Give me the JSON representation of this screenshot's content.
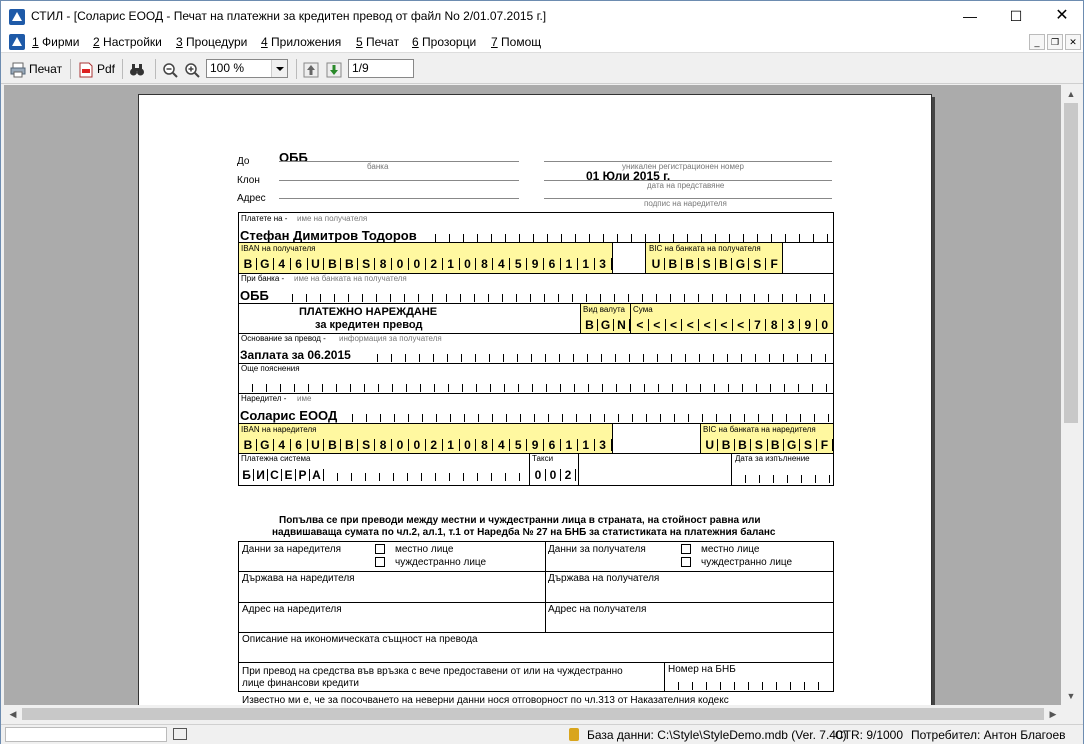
{
  "window": {
    "title": "СТИЛ - [Соларис ЕООД - Печат на платежни за кредитен превод от файл No 2/01.07.2015 г.]"
  },
  "menu": [
    {
      "num": "1",
      "label": " Фирми"
    },
    {
      "num": "2",
      "label": " Настройки"
    },
    {
      "num": "3",
      "label": " Процедури"
    },
    {
      "num": "4",
      "label": " Приложения"
    },
    {
      "num": "5",
      "label": " Печат"
    },
    {
      "num": "6",
      "label": " Прозорци"
    },
    {
      "num": "7",
      "label": " Помощ"
    }
  ],
  "toolbar": {
    "print_label": "Печат",
    "pdf_label": "Pdf",
    "zoom": "100 %",
    "page": "1/9"
  },
  "form": {
    "do_label": "До",
    "bank_value": "ОББ",
    "bank_hint": "банка",
    "klon_label": "Клон",
    "adres_label": "Адрес",
    "reg_hint": "уникален регистрационен номер",
    "date_value": "01 Юли 2015 г.",
    "date_hint": "дата на представяне",
    "sign_hint": "подпис на наредителя",
    "payee_label": "Платете на -",
    "payee_hint": "име на получателя",
    "payee_name": "Стефан Димитров Тодоров",
    "iban_payee_label": "IBAN на получателя",
    "iban_payee": "BG46UBBS80021084596113",
    "bic_payee_label": "BIC на банката на получателя",
    "bic_payee": "UBBSBGSF",
    "at_bank_label": "При банка -",
    "at_bank_hint": "име на банката на получателя",
    "at_bank": "ОББ",
    "doc_title1": "ПЛАТЕЖНО НАРЕЖДАНЕ",
    "doc_title2": "за кредитен превод",
    "currency_label": "Вид валута",
    "currency": "BGN",
    "amount_label": "Сума",
    "amount": "<<<<<<<7839|0",
    "reason_label": "Основание за превод -",
    "reason_hint": "информация за получателя",
    "reason": "Заплата за 06.2015",
    "more_label": "Още пояснения",
    "payer_label": "Наредител -",
    "payer_hint": "име",
    "payer_name": "Соларис ЕООД",
    "iban_payer_label": "IBAN на наредителя",
    "iban_payer": "BG46UBBS80021084596113",
    "bic_payer_label": "BIC на банката на наредителя",
    "bic_payer": "UBBSBGSF",
    "system_label": "Платежна система",
    "system": "БИСЕРА",
    "fees_label": "Такси",
    "fees": "002",
    "exec_label": "Дата за изпълнение",
    "note1": "Попълва се при преводи между местни и чуждестранни лица в страната, на стойност равна или",
    "note2": "надвишаваща сумата по чл.2, ал.1, т.1 от Наредба № 27 на БНБ за статистиката на платежния баланс",
    "payer_data": "Данни за наредителя",
    "payee_data": "Данни за получателя",
    "local": "местно лице",
    "foreign": "чуждестранно лице",
    "payer_country": "Държава на наредителя",
    "payee_country": "Държава на получателя",
    "payer_address": "Адрес на наредителя",
    "payee_address": "Адрес на получателя",
    "economic": "Описание на икономическата същност на превода",
    "credits1": "При превод на средства във връзка с вече предоставени от или на чуждестранно",
    "credits2": "лице финансови кредити",
    "bnb_number": "Номер на БНБ",
    "footer": "Известно ми е, че за посочването на неверни данни нося отговорност по чл.313 от Наказателния кодекс"
  },
  "status": {
    "db": "База данни: C:\\Style\\StyleDemo.mdb (Ver. 7.40)",
    "ctr": "CTR: 9/1000",
    "user": "Потребител: Антон Благоев"
  },
  "colors": {
    "highlight": "#fff8a0",
    "accent": "#1e5aa8"
  }
}
